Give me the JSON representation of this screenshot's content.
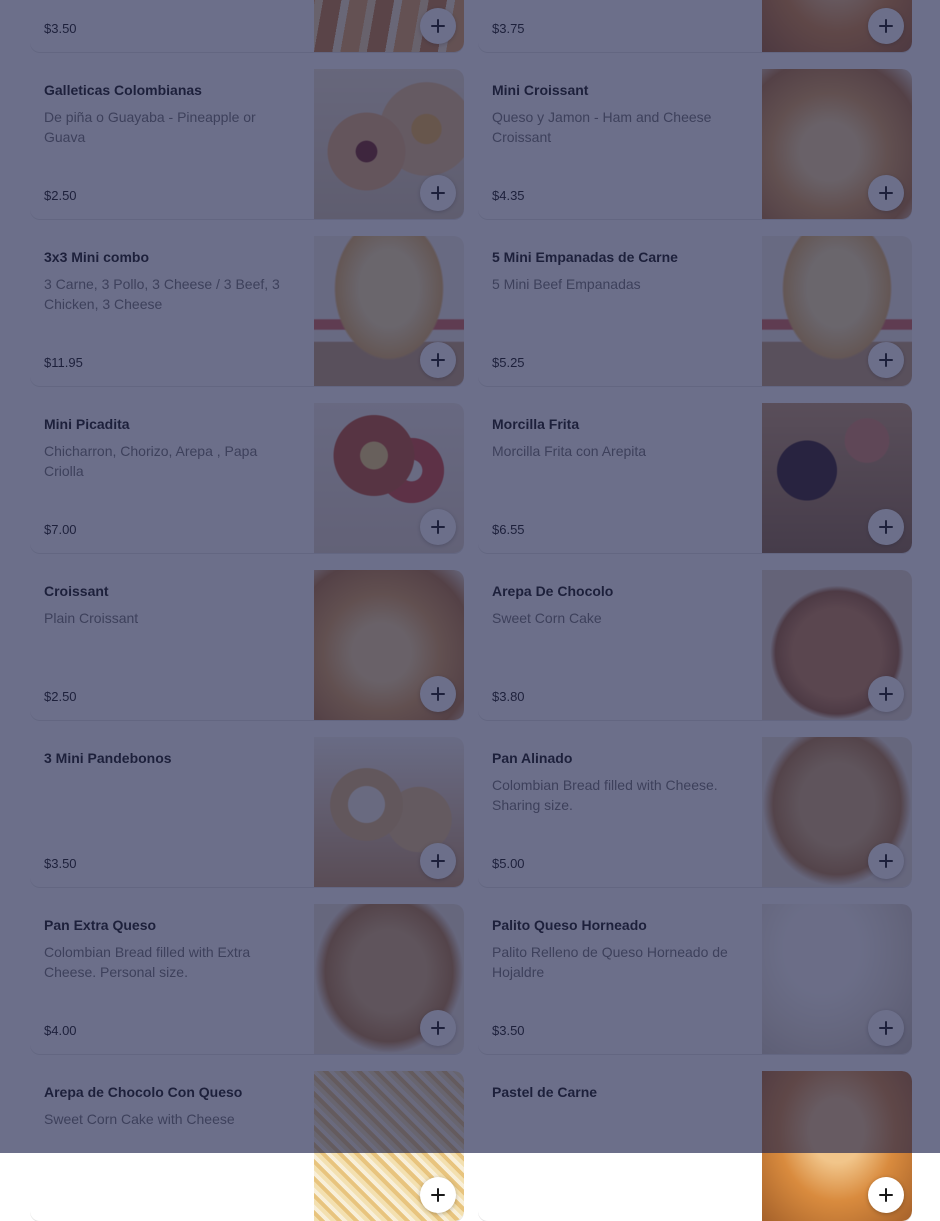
{
  "items": [
    {
      "title": "",
      "desc": "",
      "price": "$3.50",
      "img": "palito"
    },
    {
      "title": "",
      "desc": "",
      "price": "$3.75",
      "img": "pastry"
    },
    {
      "title": "Galleticas Colombianas",
      "desc": "De piña o Guayaba - Pineapple or Guava",
      "price": "$2.50",
      "img": "cookies"
    },
    {
      "title": "Mini Croissant",
      "desc": "Queso y Jamon - Ham and Cheese Croissant",
      "price": "$4.35",
      "img": "croissant"
    },
    {
      "title": "3x3 Mini combo",
      "desc": "3 Carne, 3 Pollo, 3 Cheese / 3 Beef, 3 Chicken, 3 Cheese",
      "price": "$11.95",
      "img": "empanadas-cup"
    },
    {
      "title": "5 Mini Empanadas de Carne",
      "desc": "5 Mini Beef Empanadas",
      "price": "$5.25",
      "img": "empanadas-cup"
    },
    {
      "title": "Mini Picadita",
      "desc": "Chicharron, Chorizo, Arepa , Papa Criolla",
      "price": "$7.00",
      "img": "picadita"
    },
    {
      "title": "Morcilla Frita",
      "desc": "Morcilla Frita con Arepita",
      "price": "$6.55",
      "img": "morcilla"
    },
    {
      "title": "Croissant",
      "desc": "Plain Croissant",
      "price": "$2.50",
      "img": "croissant"
    },
    {
      "title": "Arepa De Chocolo",
      "desc": "Sweet Corn Cake",
      "price": "$3.80",
      "img": "arepa"
    },
    {
      "title": "3 Mini Pandebonos",
      "desc": "",
      "price": "$3.50",
      "img": "pandebono"
    },
    {
      "title": "Pan Alinado",
      "desc": "Colombian Bread filled with Cheese. Sharing size.",
      "price": "$5.00",
      "img": "bread"
    },
    {
      "title": "Pan Extra Queso",
      "desc": "Colombian Bread filled with Extra Cheese. Personal size.",
      "price": "$4.00",
      "img": "bread"
    },
    {
      "title": "Palito Queso Horneado",
      "desc": "Palito Relleno de Queso Horneado de Hojaldre",
      "price": "$3.50",
      "img": "palito-white"
    },
    {
      "title": "Arepa de Chocolo Con Queso",
      "desc": "Sweet Corn Cake with Cheese",
      "price": "",
      "img": "cheese"
    },
    {
      "title": "Pastel de Carne",
      "desc": "",
      "price": "",
      "img": "pastry"
    }
  ],
  "colors": {
    "overlay": "#20244e",
    "text": "#191919",
    "muted": "#767676"
  },
  "icons": {
    "add": "plus-icon"
  }
}
